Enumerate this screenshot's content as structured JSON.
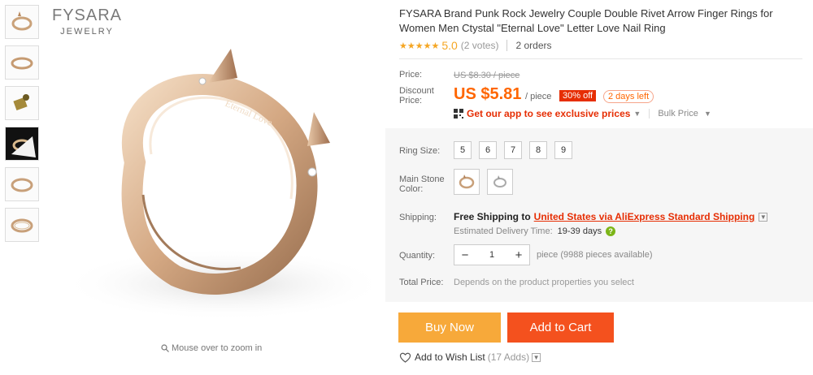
{
  "gallery": {
    "thumbnails": [
      {
        "name": "thumb-1",
        "bg": "#fbfbfb"
      },
      {
        "name": "thumb-2",
        "bg": "#fbfbfb"
      },
      {
        "name": "thumb-3",
        "bg": "#fbfbfb"
      },
      {
        "name": "thumb-4",
        "bg": "#111111"
      },
      {
        "name": "thumb-5",
        "bg": "#fbfbfb"
      },
      {
        "name": "thumb-6",
        "bg": "#fbfbfb"
      }
    ],
    "brand_line1": "FYSARA",
    "brand_line2": "JEWELRY",
    "zoom_hint": "Mouse over to zoom in"
  },
  "product": {
    "title": "FYSARA Brand Punk Rock Jewelry Couple Double Rivet Arrow Finger Rings for Women Men Ctystal \"Eternal Love\" Letter Love Nail Ring",
    "stars": "★★★★★",
    "rating": "5.0",
    "votes": "(2 votes)",
    "orders": "2 orders"
  },
  "price": {
    "price_label": "Price:",
    "old_price": "US $8.30 / piece",
    "discount_label": "Discount Price:",
    "new_price": "US $5.81",
    "per_piece": "/ piece",
    "off_badge": "30% off",
    "days_left": "2 days left",
    "app_promo": "Get our app to see exclusive prices",
    "bulk_price": "Bulk Price"
  },
  "options": {
    "ring_size_label": "Ring Size:",
    "sizes": [
      "5",
      "6",
      "7",
      "8",
      "9"
    ],
    "stone_color_label": "Main Stone Color:",
    "stone_colors": [
      "gold-ring",
      "silver-ring"
    ]
  },
  "shipping": {
    "label": "Shipping:",
    "free": "Free Shipping to",
    "link": "United States via AliExpress Standard Shipping",
    "est_label": "Estimated Delivery Time:",
    "est_days": "19-39 days"
  },
  "quantity": {
    "label": "Quantity:",
    "value": "1",
    "available": "piece (9988 pieces available)"
  },
  "total": {
    "label": "Total Price:",
    "text": "Depends on the product properties you select"
  },
  "actions": {
    "buy_now": "Buy Now",
    "add_to_cart": "Add to Cart",
    "wishlist": "Add to Wish List",
    "wishlist_count": "(17 Adds)"
  },
  "colors": {
    "accent": "#ff6600",
    "buy_now_bg": "#f7a93a",
    "add_cart_bg": "#f4511e",
    "badge_red": "#e62e04"
  }
}
